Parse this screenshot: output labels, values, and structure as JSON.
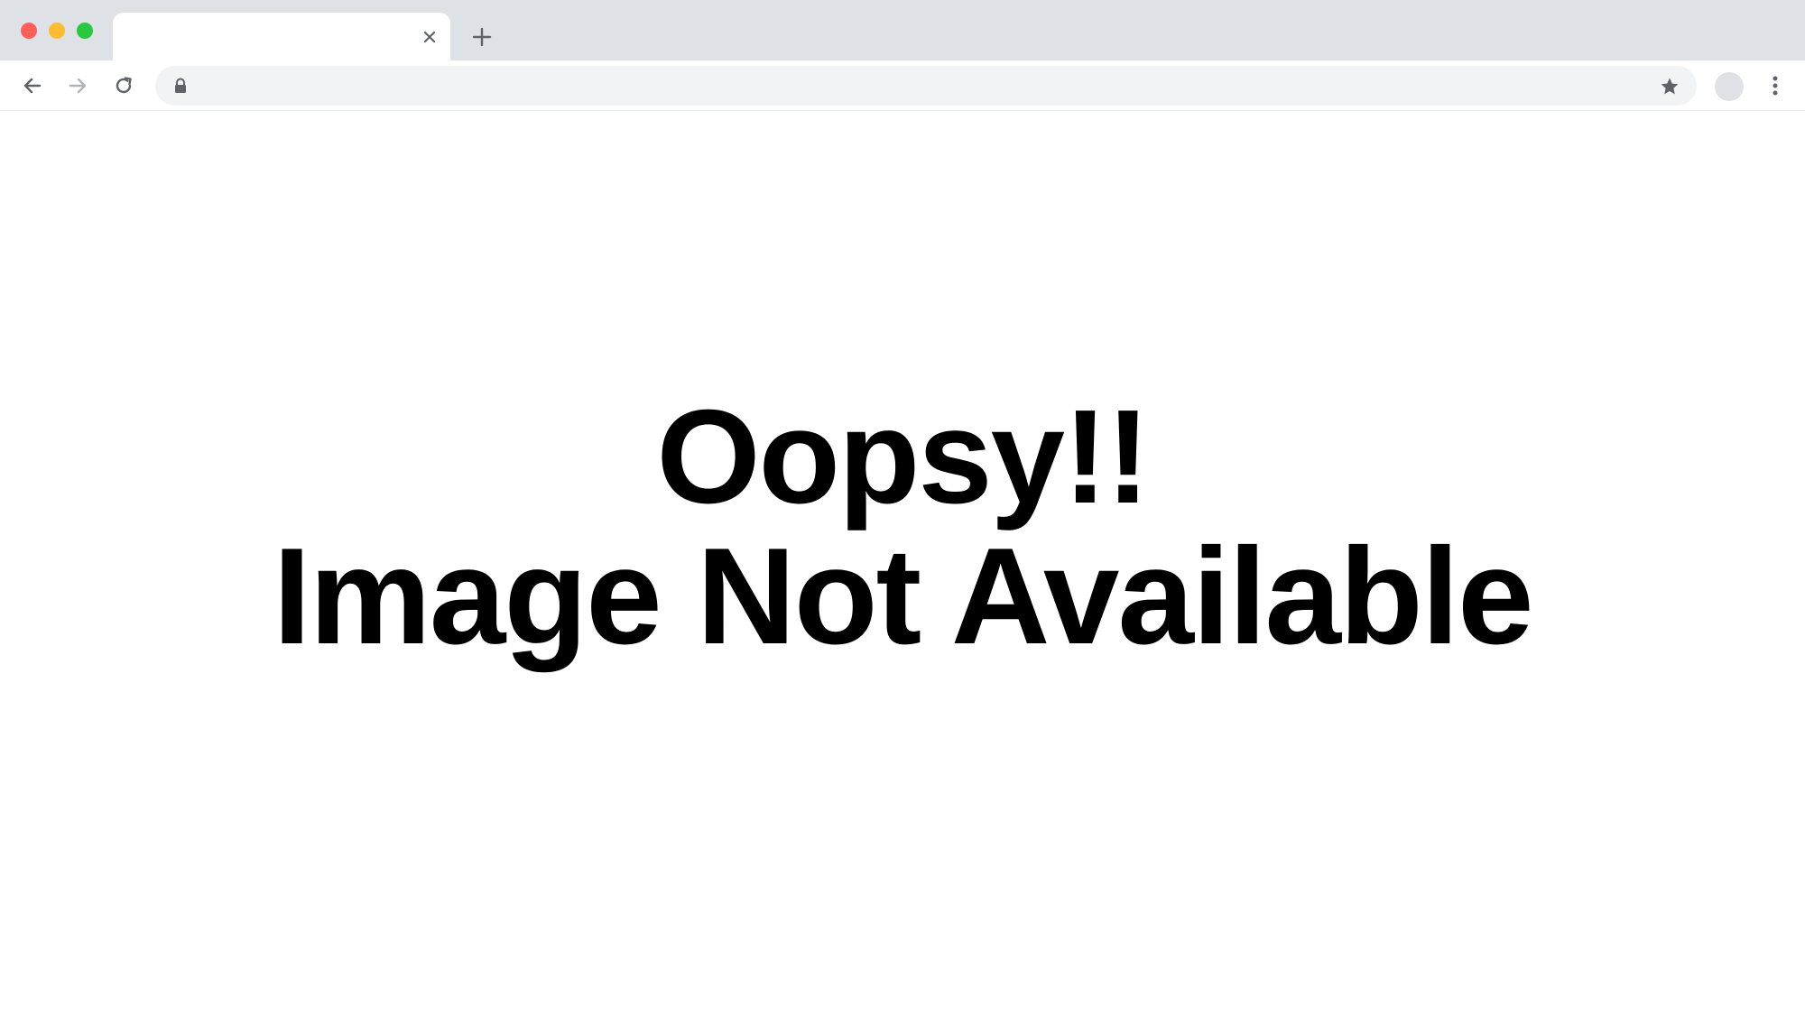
{
  "window": {
    "colors": {
      "close": "#ff5f57",
      "minimize": "#febc2e",
      "maximize": "#28c840",
      "tab_strip": "#dee1e6",
      "omnibox": "#f1f3f4",
      "icon": "#5f6368"
    }
  },
  "tab": {
    "title": "",
    "close_icon": "close-icon"
  },
  "new_tab": {
    "icon": "plus-icon"
  },
  "toolbar": {
    "back_icon": "arrow-left-icon",
    "forward_icon": "arrow-right-icon",
    "reload_icon": "reload-icon",
    "lock_icon": "lock-icon",
    "url": "",
    "bookmark_icon": "star-icon",
    "menu_icon": "more-vertical-icon"
  },
  "page": {
    "message_line_1": "Oopsy!!",
    "message_line_2": "Image Not Available"
  }
}
